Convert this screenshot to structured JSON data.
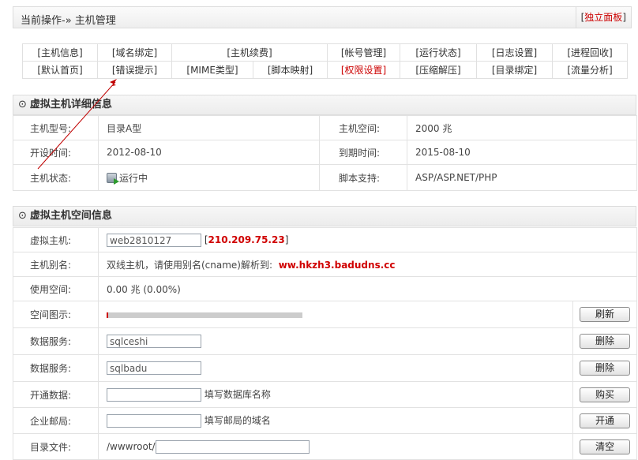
{
  "header": {
    "breadcrumb": "当前操作-» 主机管理",
    "standalone_bracket_open": "[",
    "standalone_label": "独立面板",
    "standalone_bracket_close": "]"
  },
  "nav": {
    "row1": [
      "[主机信息]",
      "[域名绑定]",
      "[主机续费]",
      "[帐号管理]",
      "[运行状态]",
      "[日志设置]",
      "[进程回收]"
    ],
    "row2": [
      "[默认首页]",
      "[错误提示]",
      "[MIME类型]",
      "[脚本映射]",
      "[权限设置]",
      "[压缩解压]",
      "[目录绑定]",
      "[流量分析]"
    ],
    "highlighted": "[权限设置]"
  },
  "detail": {
    "title": "虚拟主机详细信息",
    "bullet": "⊙",
    "model_label": "主机型号:",
    "model_value": "目录A型",
    "space_label": "主机空间:",
    "space_value": "2000 兆",
    "open_label": "开设时间:",
    "open_value": "2012-08-10",
    "expire_label": "到期时间:",
    "expire_value": "2015-08-10",
    "status_label": "主机状态:",
    "status_value": "运行中",
    "status_icon": "server-running-icon",
    "script_label": "脚本支持:",
    "script_value": "ASP/ASP.NET/PHP"
  },
  "space": {
    "title": "虚拟主机空间信息",
    "bullet": "⊙",
    "host_label": "虚拟主机:",
    "host_value": "web2810127",
    "ip_open": "[",
    "ip": "210.209.75.23",
    "ip_close": "]",
    "alias_label": "主机别名:",
    "alias_text": "双线主机，请使用别名(cname)解析到:",
    "alias_domain": "ww.hkzh3.badudns.cc",
    "usage_label": "使用空间:",
    "usage_value": "0.00 兆  (0.00%)",
    "usage_fraction": 0.0,
    "chart_label": "空间图示:",
    "refresh_button": "刷新",
    "db1_label": "数据服务:",
    "db1_value": "sqlceshi",
    "db1_button": "删除",
    "db2_label": "数据服务:",
    "db2_value": "sqlbadu",
    "db2_button": "删除",
    "opendb_label": "开通数据:",
    "opendb_hint": "填写数据库名称",
    "opendb_button": "购买",
    "mail_label": "企业邮局:",
    "mail_hint": "填写邮局的域名",
    "mail_button": "开通",
    "dir_label": "目录文件:",
    "dir_prefix": "/wwwroot/",
    "dir_button": "清空"
  },
  "colors": {
    "accent_red": "#cc0000",
    "border": "#e2e2e2",
    "usage_bar": "#cccccc"
  }
}
